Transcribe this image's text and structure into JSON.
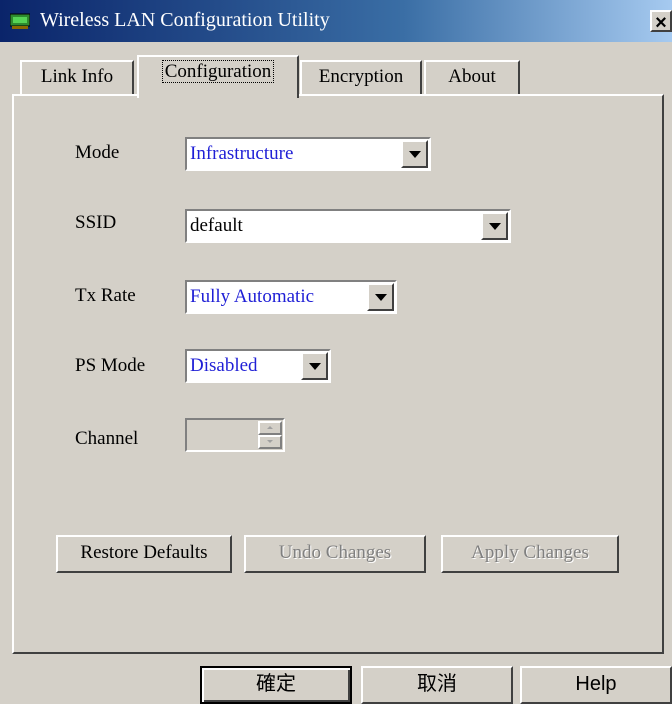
{
  "window": {
    "title": "Wireless LAN Configuration Utility",
    "icon": "network-adapter-icon",
    "close_glyph": "×"
  },
  "tabs": [
    {
      "label": "Link Info",
      "active": false
    },
    {
      "label": "Configuration",
      "active": true
    },
    {
      "label": "Encryption",
      "active": false
    },
    {
      "label": "About",
      "active": false
    }
  ],
  "form": {
    "mode": {
      "label": "Mode",
      "value": "Infrastructure"
    },
    "ssid": {
      "label": "SSID",
      "value": "default"
    },
    "tx_rate": {
      "label": "Tx Rate",
      "value": "Fully Automatic"
    },
    "ps_mode": {
      "label": "PS Mode",
      "value": "Disabled"
    },
    "channel": {
      "label": "Channel",
      "value": "",
      "enabled": false
    }
  },
  "actions": {
    "restore": {
      "label": "Restore Defaults",
      "enabled": true
    },
    "undo": {
      "label": "Undo Changes",
      "enabled": false
    },
    "apply": {
      "label": "Apply Changes",
      "enabled": false
    }
  },
  "dialog_buttons": {
    "ok": "確定",
    "cancel": "取消",
    "help": "Help"
  },
  "colors": {
    "titlebar_start": "#0a246a",
    "titlebar_end": "#a6caf0",
    "face": "#d4d0c8",
    "value_text": "#1f1fd6"
  }
}
